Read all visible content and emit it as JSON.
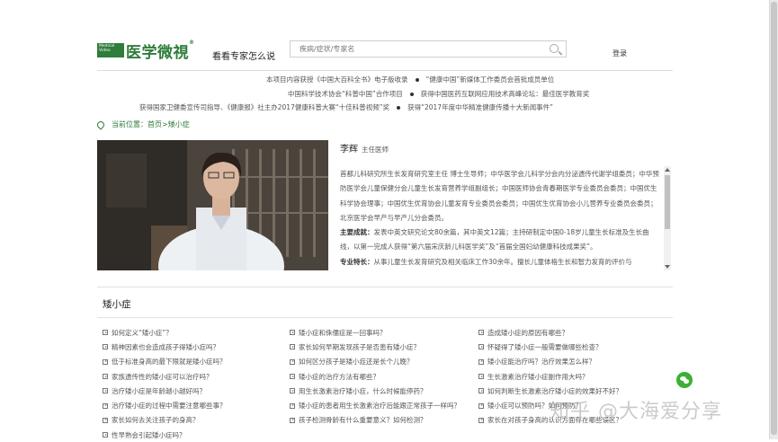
{
  "header": {
    "logo_small": "Medical Video",
    "logo_text": "医学微視",
    "logo_reg": "®",
    "slogan": "看看专家怎么说",
    "search_placeholder": "疾病/症状/专家名",
    "login": "登录"
  },
  "credentials": [
    [
      "本项目内容获授《中国大百科全书》电子版收录",
      "“健康中国”新媒体工作委员会首批成员单位"
    ],
    [
      "中国科学技术协会“科普中国”合作项目",
      "获得中国医药互联网应用技术高峰论坛：最佳医学教育奖"
    ],
    [
      "获得国家卫健委宣传司指导、《健康报》社主办2017健康科普大赛“十佳科普视频”奖",
      "获得“2017年度中华精准健康传播十大新闻事件”"
    ]
  ],
  "breadcrumb": {
    "prefix": "当前位置：",
    "home": "首页",
    "sep": ">",
    "current": "矮小症"
  },
  "doctor": {
    "name": "李辉",
    "title": "主任医师",
    "bio_intro": "首都儿科研究所生长发育研究室主任 博士生导师；中华医学会儿科学分会内分泌遗传代谢学组委员；中华预防医学会儿童保健分会儿童生长发育营养学组副组长；中国医师协会青春期医学专业委员会委员；中国优生科学协会理事；中国优生优育协会儿童发育专业委员会委员；中国优生优育协会小儿营养专业委员会委员；北京医学会早产与早产儿分会委员。",
    "achievements_label": "主要成就：",
    "achievements": "发表中英文研究论文80余篇，其中英文12篇；主持研制定中国0-18岁儿童生长标准及生长曲线，以第一完成人获得“第六届宋庆龄儿科医学奖”及“首届全国妇幼健康科技成果奖”。",
    "specialty_label": "专业特长：",
    "specialty": "从事儿童生长发育研究及相关临床工作30余年。擅长儿童体格生长和智力发育的评价与"
  },
  "section": {
    "title": "矮小症"
  },
  "questions": [
    [
      "如何定义“矮小症”？",
      "精神因素也会造成孩子得矮小症吗？",
      "低于标准身高的最下限就是矮小症吗？",
      "家族遗传性的矮小症可以治疗吗？",
      "治疗矮小症是年龄越小越好吗？",
      "治疗矮小症的过程中需要注意哪些事？",
      "家长如何去关注孩子的身高？",
      "性早熟会引起矮小症吗？"
    ],
    [
      "矮小症和侏儒症是一回事吗？",
      "家长如何早期发现孩子是否患有矮小症？",
      "如何区分孩子是矮小症还是长个儿晚？",
      "矮小症的治疗方法有哪些？",
      "用生长激素治疗矮小症，什么时候能停药？",
      "矮小症的患者用生长激素治疗后能跟正常孩子一样吗？",
      "孩子检测骨龄有什么重要意义？如何检测？"
    ],
    [
      "造成矮小症的原因有哪些？",
      "怀疑得了矮小症一般需要做哪些检查？",
      "矮小症能治疗吗？治疗效果怎么样？",
      "生长激素治疗矮小症副作用大吗？",
      "如何判断生长激素治疗矮小症的效果好不好？",
      "矮小症可以预防吗？如何预防？",
      "家长在对孩子身高的认识方面存在哪些误区？"
    ]
  ],
  "watermark": "知乎 @大海爱分享"
}
